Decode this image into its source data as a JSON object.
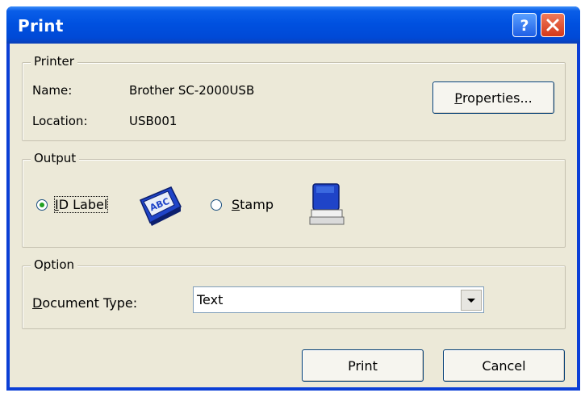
{
  "window": {
    "title": "Print"
  },
  "printer": {
    "legend": "Printer",
    "name_label": "Name:",
    "name_value": "Brother SC-2000USB",
    "location_label": "Location:",
    "location_value": "USB001",
    "properties_prefix": "",
    "properties_mnemonic": "P",
    "properties_rest": "roperties..."
  },
  "output": {
    "legend": "Output",
    "id_label_mnemonic": "I",
    "id_label_rest": "D Label",
    "stamp_mnemonic": "S",
    "stamp_rest": "tamp",
    "selected": "ID Label"
  },
  "option": {
    "legend": "Option",
    "doc_type_mnemonic": "D",
    "doc_type_rest": "ocument Type:",
    "doc_type_value": "Text"
  },
  "buttons": {
    "print": "Print",
    "cancel": "Cancel"
  },
  "icons": {
    "help": "question-icon",
    "close": "close-icon",
    "id_label": "id-label-tape-icon",
    "stamp": "stamp-icon",
    "dropdown": "dropdown-arrow-icon"
  },
  "colors": {
    "titlebar": "#0054e3",
    "client": "#ece9d8",
    "close": "#e04b2a",
    "radio_dot": "#21a121"
  }
}
